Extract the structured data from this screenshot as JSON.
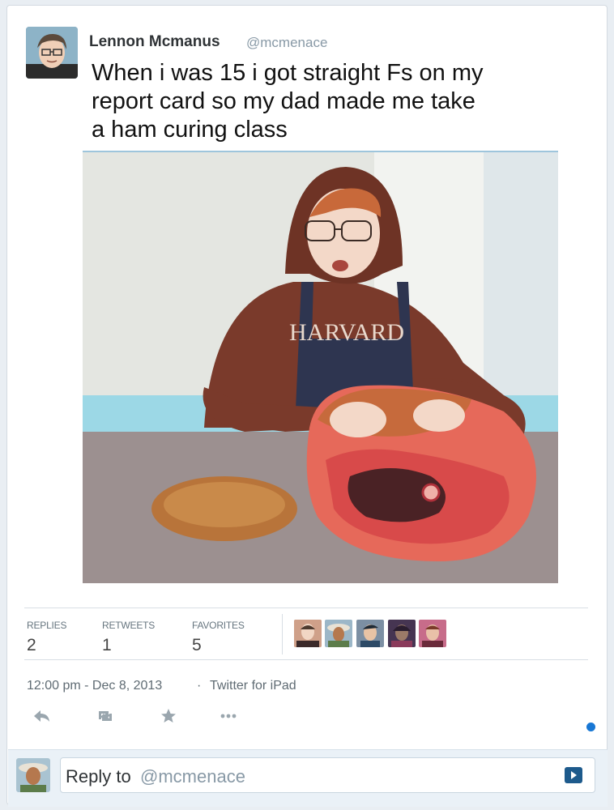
{
  "tweet": {
    "author_name": "Lennon Mcmanus",
    "author_handle": "@mcmenace",
    "text_line1": "When i was 15 i got straight Fs on my",
    "text_line2": "report card so my dad made me take",
    "text_line3": "a ham curing class"
  },
  "media": {
    "sweatshirt_text": "HARVARD"
  },
  "stats": {
    "replies_label": "REPLIES",
    "replies_value": "2",
    "retweets_label": "RETWEETS",
    "retweets_value": "1",
    "favorites_label": "FAVORITES",
    "favorites_value": "5"
  },
  "meta": {
    "timestamp": "12:00 pm - Dec 8, 2013",
    "separator": "·",
    "source": "Twitter for iPad"
  },
  "actions": [
    "reply-icon",
    "retweet-icon",
    "favorite-icon",
    "more-icon"
  ],
  "reply": {
    "label": "Reply to",
    "handle": "@mcmenace"
  },
  "colors": {
    "accent": "#1877d4",
    "background": "#e9eef3",
    "card": "#ffffff",
    "muted_text": "#8899a6"
  }
}
